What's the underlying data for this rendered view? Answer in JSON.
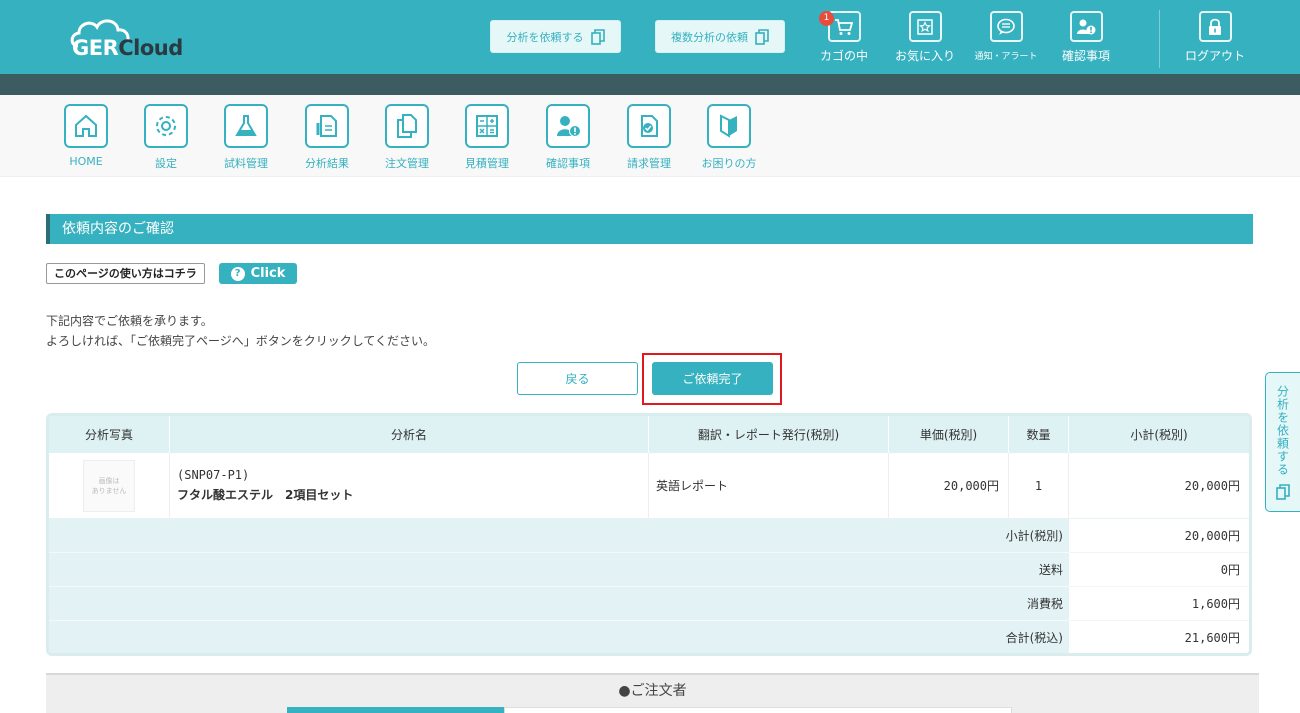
{
  "header": {
    "logo": {
      "part1": "GER",
      "part2": "Cloud"
    },
    "request_analysis_label": "分析を依頼する",
    "multi_analysis_label": "複数分析の依頼",
    "icons": [
      {
        "label": "カゴの中",
        "icon": "cart-icon",
        "badge": "1"
      },
      {
        "label": "お気に入り",
        "icon": "star-icon"
      },
      {
        "label": "通知・アラート",
        "icon": "chat-icon"
      },
      {
        "label": "確認事項",
        "icon": "user-alert-icon"
      },
      {
        "label": "ログアウト",
        "icon": "lock-icon"
      }
    ]
  },
  "menu": [
    {
      "label": "HOME",
      "icon": "home-icon"
    },
    {
      "label": "設定",
      "icon": "gear-icon"
    },
    {
      "label": "試料管理",
      "icon": "flask-icon"
    },
    {
      "label": "分析結果",
      "icon": "report-icon"
    },
    {
      "label": "注文管理",
      "icon": "documents-icon"
    },
    {
      "label": "見積管理",
      "icon": "calculator-icon"
    },
    {
      "label": "確認事項",
      "icon": "user-alert-icon"
    },
    {
      "label": "請求管理",
      "icon": "invoice-icon"
    },
    {
      "label": "お困りの方",
      "icon": "beginner-icon"
    }
  ],
  "page": {
    "section_title": "依頼内容のご確認",
    "howto_label": "このページの使い方はコチラ",
    "click_label": "Click",
    "intro_line1": "下記内容でご依頼を承ります。",
    "intro_line2": "よろしければ、「ご依頼完了ページへ」ボタンをクリックしてください。",
    "back_label": "戻る",
    "done_label": "ご依頼完了"
  },
  "table": {
    "headers": [
      "分析写真",
      "分析名",
      "翻訳・レポート発行(税別)",
      "単価(税別)",
      "数量",
      "小計(税別)"
    ],
    "row": {
      "photo_placeholder_line1": "画像は",
      "photo_placeholder_line2": "ありません",
      "code": "(SNP07-P1)",
      "name": "フタル酸エステル　2項目セット",
      "report": "英語レポート",
      "unit_price": "20,000円",
      "quantity": "1",
      "subtotal": "20,000円"
    },
    "summary": [
      {
        "label": "小計(税別)",
        "value": "20,000円"
      },
      {
        "label": "送料",
        "value": "0円"
      },
      {
        "label": "消費税",
        "value": "1,600円"
      },
      {
        "label": "合計(税込)",
        "value": "21,600円"
      }
    ]
  },
  "orderer_title": "●ご注文者",
  "side_tab_label": "分析を依頼する",
  "colors": {
    "accent": "#35b1bf",
    "dark_band": "#3d5c62",
    "highlight_border": "#e0191e"
  }
}
